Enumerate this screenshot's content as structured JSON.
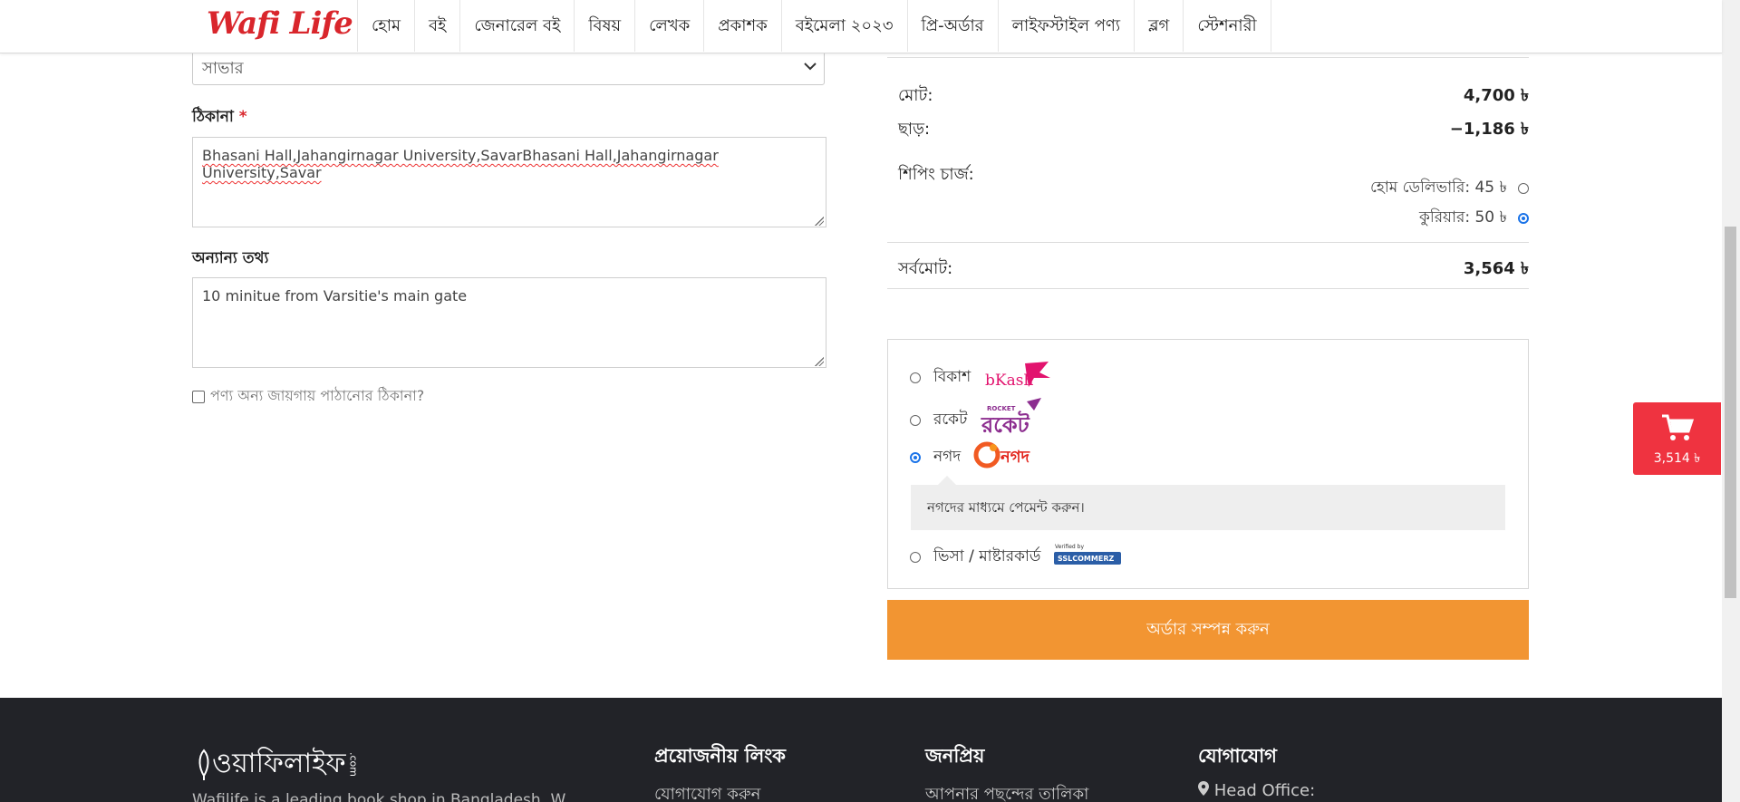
{
  "header": {
    "logo": "Wafi Life",
    "nav": [
      "হোম",
      "বই",
      "জেনারেল বই",
      "বিষয়",
      "লেখক",
      "প্রকাশক",
      "বইমেলা ২০২৩",
      "প্রি-অর্ডার",
      "লাইফস্টাইল পণ্য",
      "ব্লগ",
      "স্টেশনারী"
    ]
  },
  "form": {
    "area_select_value": "সাভার",
    "address_label": "ঠিকানা",
    "address_required_mark": "*",
    "address_value": "Bhasani Hall,Jahangirnagar University,SavarBhasani Hall,Jahangirnagar University,Savar",
    "other_info_label": "অন্যান্য তথ্য",
    "other_info_value": "10 minitue from Varsitie's main gate",
    "ship_elsewhere_label": "পণ্য অন্য জায়গায় পাঠানোর ঠিকানা?"
  },
  "summary": {
    "total_label": "মোট:",
    "total_value": "4,700 ৳",
    "discount_label": "ছাড়:",
    "discount_value": "−1,186 ৳",
    "shipping_label": "শিপিং চার্জ:",
    "shipping_options": [
      {
        "label": "হোম ডেলিভারি: 45 ৳",
        "selected": false
      },
      {
        "label": "কুরিয়ার: 50 ৳",
        "selected": true
      }
    ],
    "grand_total_label": "সর্বমোট:",
    "grand_total_value": "3,564 ৳"
  },
  "payment": {
    "options": [
      {
        "label": "বিকাশ",
        "logo_text": "bKash",
        "selected": false
      },
      {
        "label": "রকেট",
        "logo_text": "রকেট",
        "logo_small": "ROCKET",
        "selected": false
      },
      {
        "label": "নগদ",
        "logo_text": "নগদ",
        "selected": true
      },
      {
        "label": "ভিসা / মাষ্টারকার্ড",
        "logo_small": "Verified by",
        "logo_text": "SSLCOMMERZ",
        "selected": false
      }
    ],
    "nagad_info": "নগদের মাধ্যমে পেমেন্ট করুন।",
    "order_button": "অর্ডার সম্পন্ন করুন"
  },
  "cart": {
    "amount": "3,514 ৳"
  },
  "footer": {
    "logo_text": "ওয়াফিলাইফ",
    "logo_suffix": ".com",
    "description": "Wafilife is a leading book shop in Bangladesh. W",
    "col1_title": "প্রয়োজনীয় লিংক",
    "col1_link": "যোগাযোগ করুন",
    "col2_title": "জনপ্রিয়",
    "col2_link": "আপনার পছন্দের তালিকা",
    "col3_title": "যোগাযোগ",
    "col3_link": "Head Office:"
  },
  "colors": {
    "brand_red": "#d9262c",
    "order_orange": "#f29532",
    "footer_bg": "#222328",
    "cart_red": "#ef3340",
    "radio_blue": "#1a73e8"
  }
}
